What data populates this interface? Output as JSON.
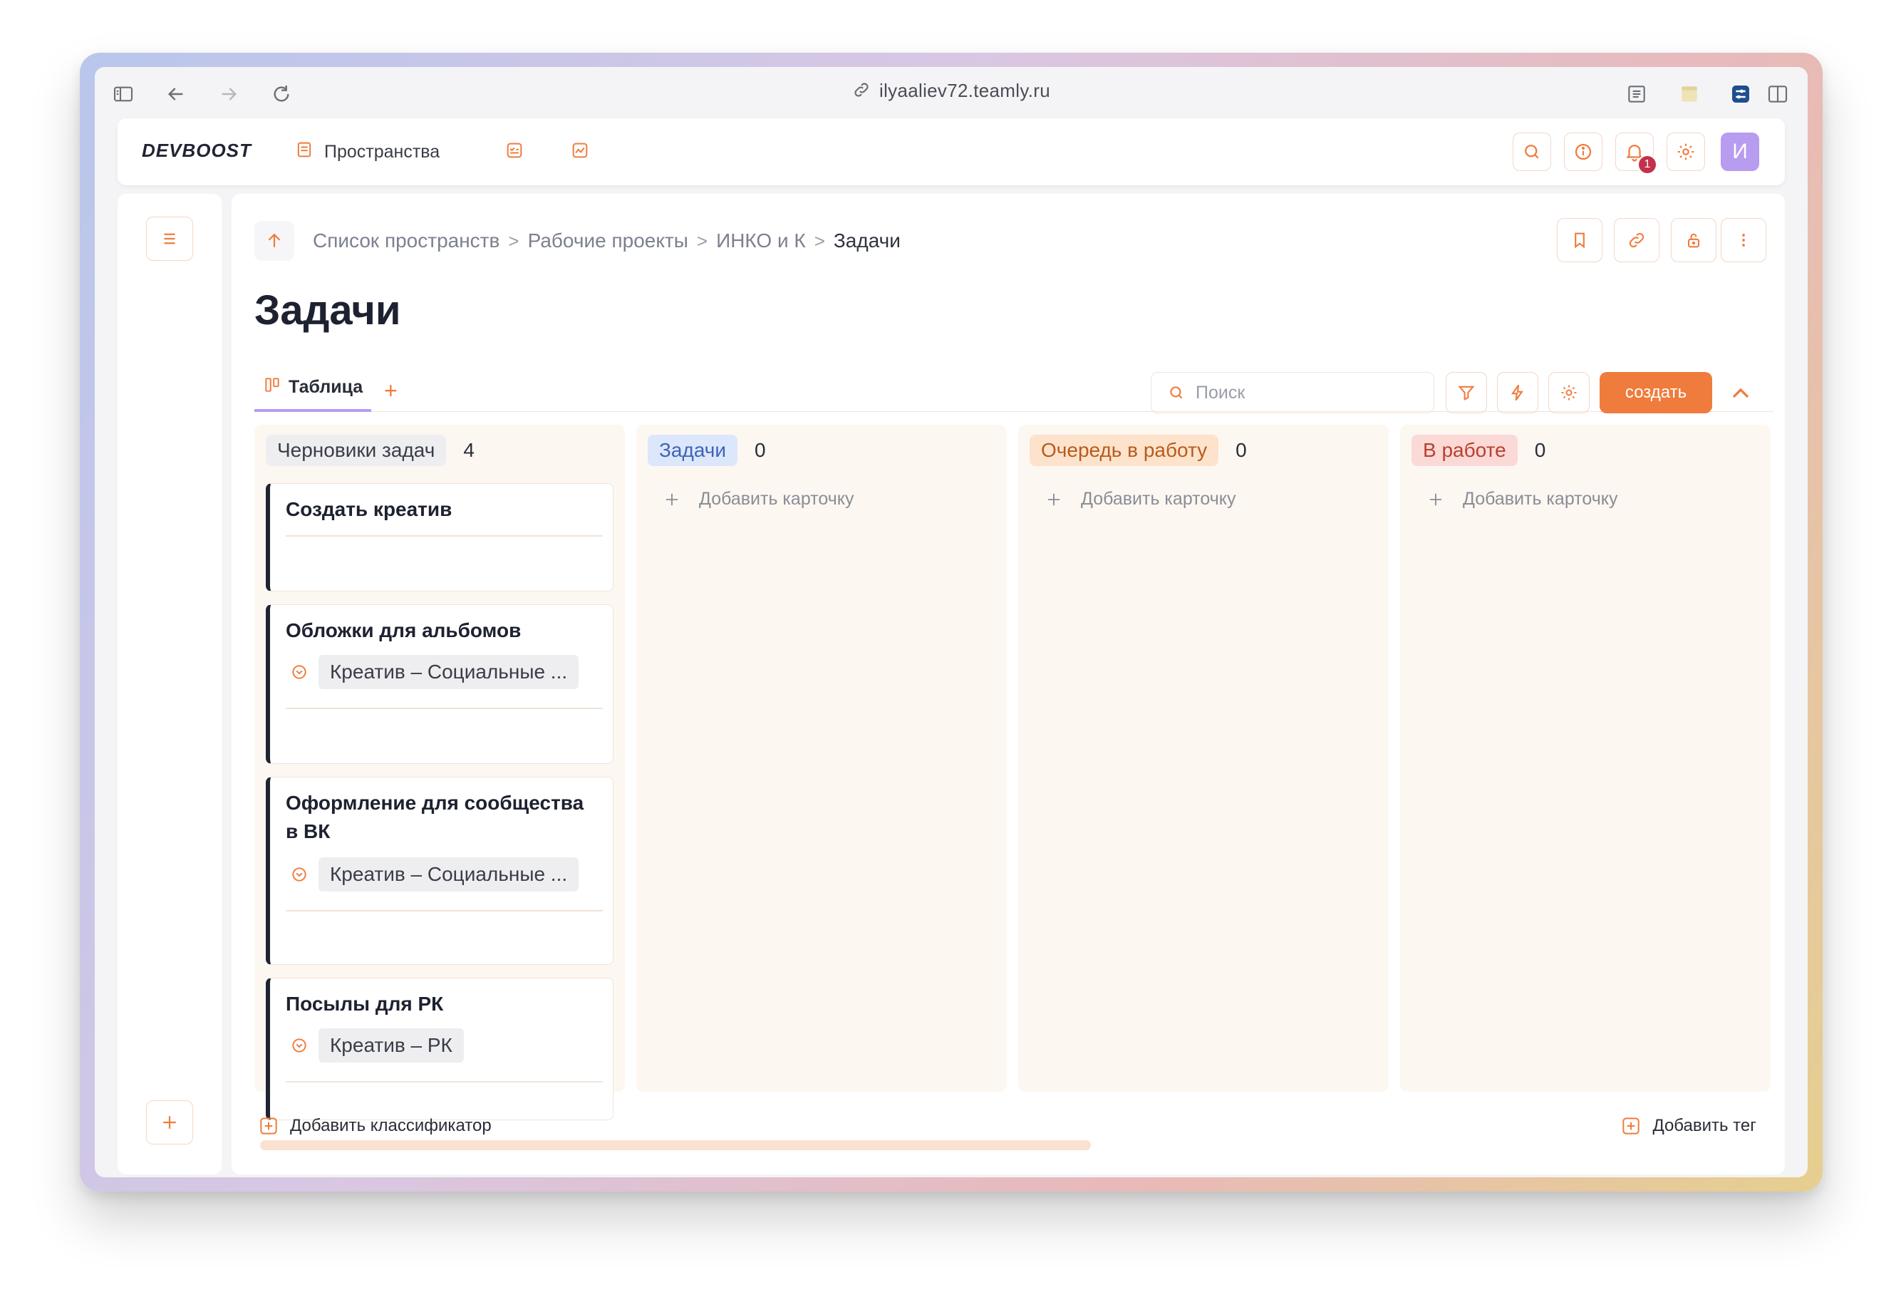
{
  "browser": {
    "url": "ilyaaliev72.teamly.ru"
  },
  "topbar": {
    "logo": "DEVBOOST",
    "spaces_label": "Пространства",
    "notifications_count": "1",
    "avatar_letter": "И"
  },
  "breadcrumb": {
    "items": [
      "Список пространств",
      "Рабочие проекты",
      "ИНКО и К"
    ],
    "current": "Задачи",
    "separator": ">"
  },
  "page": {
    "title": "Задачи"
  },
  "view": {
    "tab_label": "Таблица",
    "tab_add": "+",
    "search_placeholder": "Поиск",
    "create_label": "создать"
  },
  "columns": [
    {
      "name": "Черновики задач",
      "count": "4",
      "color": "#eeeef1",
      "text_color": "#3a3d47",
      "cards": [
        {
          "title": "Создать креатив",
          "tag": ""
        },
        {
          "title": "Обложки для альбомов",
          "tag": "Креатив – Социальные ..."
        },
        {
          "title": "Оформление для сообщества в ВК",
          "tag": "Креатив – Социальные ..."
        },
        {
          "title": "Посылы для РК",
          "tag": "Креатив – РК"
        }
      ]
    },
    {
      "name": "Задачи",
      "count": "0",
      "color": "#dde7fb",
      "text_color": "#3d63b8",
      "add_label": "Добавить карточку"
    },
    {
      "name": "Очередь в работу",
      "count": "0",
      "color": "#fde3cc",
      "text_color": "#b85b1d",
      "add_label": "Добавить карточку"
    },
    {
      "name": "В работе",
      "count": "0",
      "color": "#fbd9d6",
      "text_color": "#b8412f",
      "add_label": "Добавить карточку"
    }
  ],
  "footer": {
    "add_classifier": "Добавить классификатор",
    "add_tag": "Добавить тег"
  },
  "colors": {
    "accent": "#ef7c3c",
    "avatar": "#b79cf0",
    "badge": "#c3314b"
  }
}
